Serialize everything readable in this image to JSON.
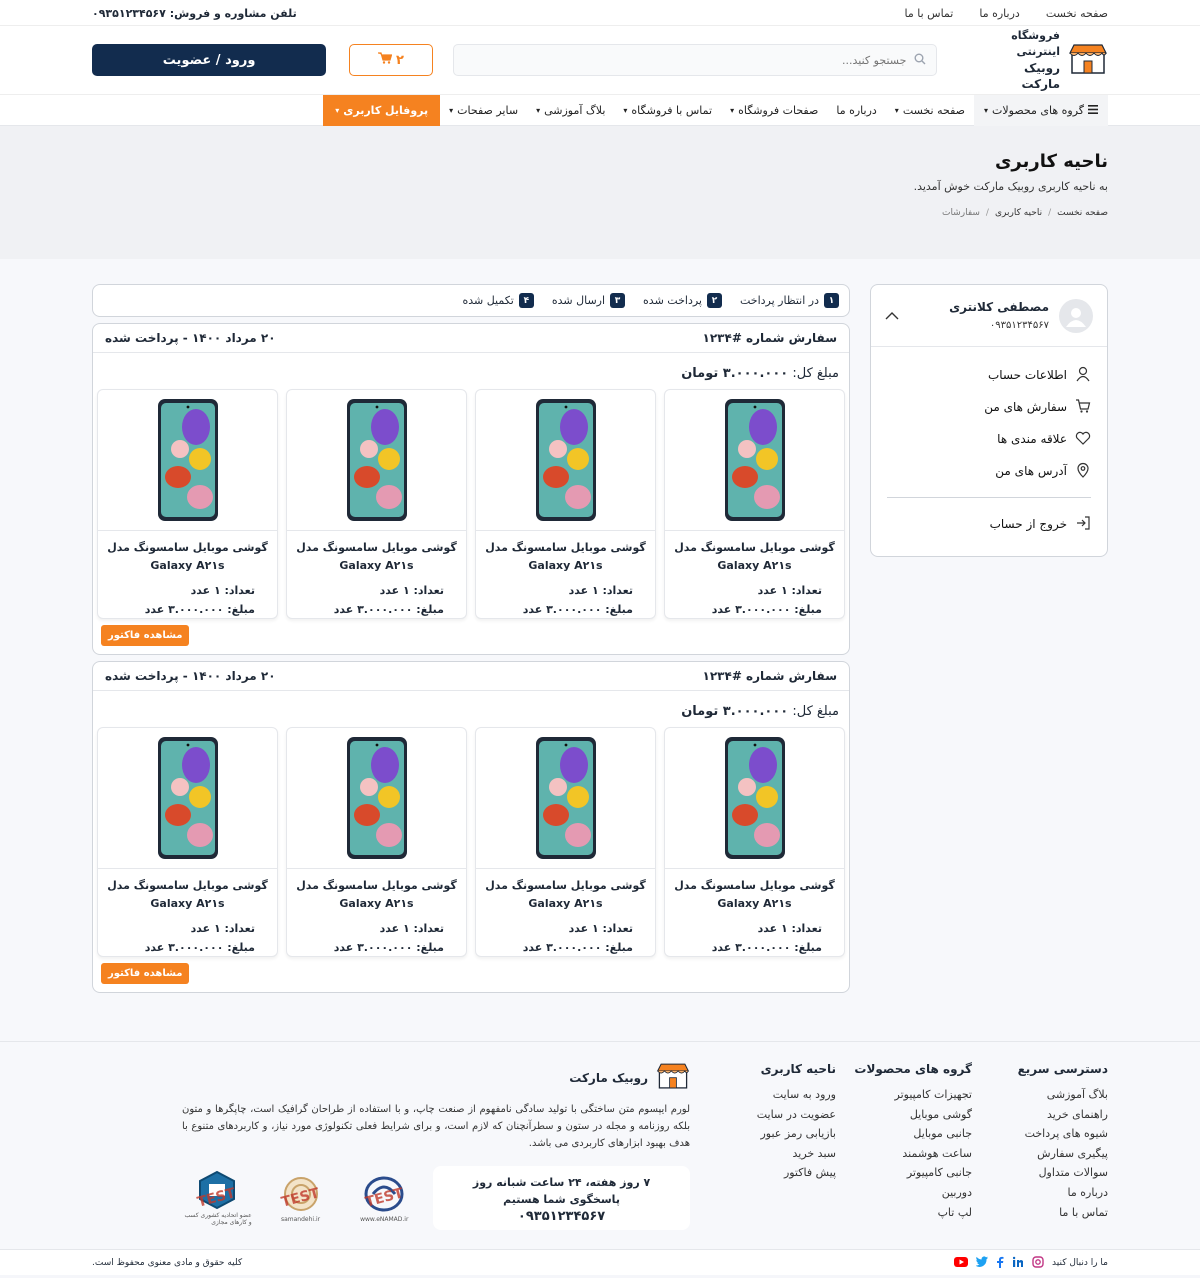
{
  "topbar": {
    "links": [
      "صفحه نخست",
      "درباره ما",
      "تماس با ما"
    ],
    "phone": "تلفن مشاوره و فروش: ۰۹۳۵۱۲۳۴۵۶۷"
  },
  "header": {
    "logo_line1": "فروشگاه اینترنتی",
    "logo_line2": "روبیک مارکت",
    "search_placeholder": "جستجو کنید...",
    "cart_count": "۲",
    "login_label": "ورود / عضویت"
  },
  "nav": {
    "items": [
      "گروه های محصولات",
      "صفحه نخست",
      "درباره ما",
      "صفحات فروشگاه",
      "تماس با فروشگاه",
      "بلاگ آموزشی",
      "سایر صفحات",
      "پروفایل کاربری"
    ]
  },
  "page_head": {
    "title": "ناحیه کاربری",
    "subtitle": "به ناحیه کاربری روبیک مارکت خوش آمدید.",
    "breadcrumb": [
      "صفحه نخست",
      "ناحیه کاربری",
      "سفارشات"
    ]
  },
  "sidebar": {
    "user_name": "مصطفی کلانتری",
    "user_phone": "۰۹۳۵۱۲۳۴۵۶۷",
    "menu": [
      "اطلاعات حساب",
      "سفارش های من",
      "علاقه مندی ها",
      "آدرس های من"
    ],
    "logout": "خروج از حساب"
  },
  "status_tabs": [
    {
      "label": "در انتظار پرداخت",
      "count": "۱"
    },
    {
      "label": "پرداخت شده",
      "count": "۲"
    },
    {
      "label": "ارسال شده",
      "count": "۳"
    },
    {
      "label": "تکمیل شده",
      "count": "۴"
    }
  ],
  "orders": [
    {
      "number": "سفارش شماره #۱۲۳۴",
      "date_status": "۲۰ مرداد ۱۴۰۰ - پرداخت شده",
      "total_label": "مبلغ کل:",
      "total_value": "۳.۰۰۰.۰۰۰ تومان",
      "invoice_label": "مشاهده فاکتور",
      "products": [
        {
          "name": "گوشی موبایل سامسونگ مدل",
          "model": "Galaxy A۲۱s",
          "qty": "تعداد: ۱ عدد",
          "price": "مبلغ: ۳.۰۰۰.۰۰۰ عدد"
        },
        {
          "name": "گوشی موبایل سامسونگ مدل",
          "model": "Galaxy A۲۱s",
          "qty": "تعداد: ۱ عدد",
          "price": "مبلغ: ۳.۰۰۰.۰۰۰ عدد"
        },
        {
          "name": "گوشی موبایل سامسونگ مدل",
          "model": "Galaxy A۲۱s",
          "qty": "تعداد: ۱ عدد",
          "price": "مبلغ: ۳.۰۰۰.۰۰۰ عدد"
        },
        {
          "name": "گوشی موبایل سامسونگ مدل",
          "model": "Galaxy A۲۱s",
          "qty": "تعداد: ۱ عدد",
          "price": "مبلغ: ۳.۰۰۰.۰۰۰ عدد"
        }
      ]
    },
    {
      "number": "سفارش شماره #۱۲۳۴",
      "date_status": "۲۰ مرداد ۱۴۰۰ - پرداخت شده",
      "total_label": "مبلغ کل:",
      "total_value": "۳.۰۰۰.۰۰۰ تومان",
      "invoice_label": "مشاهده فاکتور",
      "products": [
        {
          "name": "گوشی موبایل سامسونگ مدل",
          "model": "Galaxy A۲۱s",
          "qty": "تعداد: ۱ عدد",
          "price": "مبلغ: ۳.۰۰۰.۰۰۰ عدد"
        },
        {
          "name": "گوشی موبایل سامسونگ مدل",
          "model": "Galaxy A۲۱s",
          "qty": "تعداد: ۱ عدد",
          "price": "مبلغ: ۳.۰۰۰.۰۰۰ عدد"
        },
        {
          "name": "گوشی موبایل سامسونگ مدل",
          "model": "Galaxy A۲۱s",
          "qty": "تعداد: ۱ عدد",
          "price": "مبلغ: ۳.۰۰۰.۰۰۰ عدد"
        },
        {
          "name": "گوشی موبایل سامسونگ مدل",
          "model": "Galaxy A۲۱s",
          "qty": "تعداد: ۱ عدد",
          "price": "مبلغ: ۳.۰۰۰.۰۰۰ عدد"
        }
      ]
    }
  ],
  "footer": {
    "quick": {
      "title": "دسترسی سریع",
      "items": [
        "بلاگ آموزشی",
        "راهنمای خرید",
        "شیوه های پرداخت",
        "پیگیری سفارش",
        "سوالات متداول",
        "درباره ما",
        "تماس با ما"
      ]
    },
    "groups": {
      "title": "گروه های محصولات",
      "items": [
        "تجهیزات کامپیوتر",
        "گوشی موبایل",
        "جانبی موبایل",
        "ساعت هوشمند",
        "جانبی کامپیوتر",
        "دوربین",
        "لپ تاپ"
      ]
    },
    "account": {
      "title": "ناحیه کاربری",
      "items": [
        "ورود به سایت",
        "عضویت در سایت",
        "بازیابی رمز عبور",
        "سبد خرید",
        "پیش فاکتور"
      ]
    },
    "about_title": "روبیک مارکت",
    "about_text": "لورم ایپسوم متن ساختگی با تولید سادگی نامفهوم از صنعت چاپ، و با استفاده از طراحان گرافیک است، چاپگرها و متون بلکه روزنامه و مجله در ستون و سطرآنچنان که لازم است، و برای شرایط فعلی تکنولوژی مورد نیاز، و کاربردهای متنوع با هدف بهبود ابزارهای کاربردی می باشد.",
    "support_line1": "۷ روز هفته، ۲۴ ساعت شبانه روز",
    "support_line2": "پاسخگوی شما هستیم",
    "support_phone": "۰۹۳۵۱۲۳۴۵۶۷",
    "badges": [
      {
        "test": "TEST",
        "caption": "www.eNAMAD.ir"
      },
      {
        "test": "TEST",
        "caption": "samandehi.ir"
      },
      {
        "test": "TEST",
        "caption": "عضو اتحادیه کشوری کسب و کارهای مجازی"
      }
    ],
    "follow": "ما را دنبال کنید",
    "copyright": "کلیه حقوق و مادی معنوی محفوظ است."
  },
  "colors": {
    "accent": "#f58220",
    "primary": "#122c4e"
  }
}
